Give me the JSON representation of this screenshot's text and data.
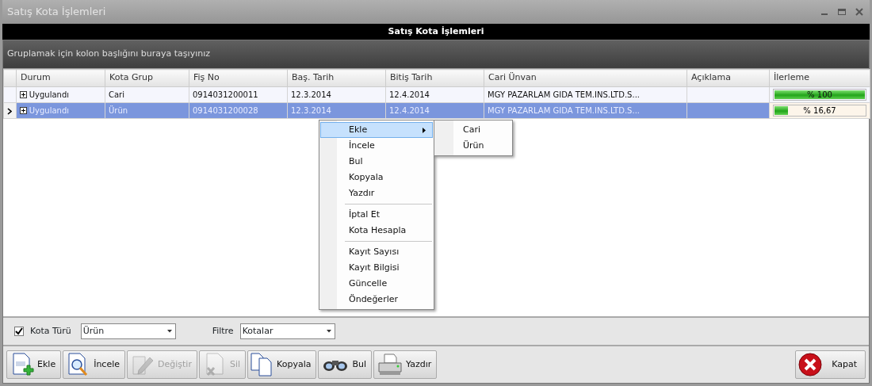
{
  "window": {
    "title": "Satış Kota İşlemleri"
  },
  "header": {
    "title": "Satış Kota İşlemleri"
  },
  "group_panel": {
    "hint": "Gruplamak için kolon başlığını buraya taşıyınız"
  },
  "table": {
    "columns": [
      "Durum",
      "Kota Grup",
      "Fiş No",
      "Baş. Tarih",
      "Bitiş Tarih",
      "Cari Ünvan",
      "Açıklama",
      "İlerleme"
    ],
    "rows": [
      {
        "selected": false,
        "cells": [
          "Uygulandı",
          "Cari",
          "0914031200011",
          "12.3.2014",
          "12.4.2014",
          "MGY PAZARLAM GIDA TEM.INS.LTD.S...",
          ""
        ],
        "progress": {
          "level": 1,
          "reading": "% 100"
        }
      },
      {
        "selected": true,
        "cells": [
          "Uygulandı",
          "Ürün",
          "0914031200028",
          "12.3.2014",
          "12.4.2014",
          "MGY PAZARLAM GIDA TEM.INS.LTD.S...",
          ""
        ],
        "progress": {
          "level": 0.1667,
          "reading": "% 16,67"
        }
      }
    ]
  },
  "context_menu": {
    "items": [
      {
        "kind": "item",
        "label": "Ekle",
        "selected": true,
        "submenu": true
      },
      {
        "kind": "item",
        "label": "İncele",
        "selected": false,
        "submenu": false
      },
      {
        "kind": "item",
        "label": "Bul",
        "selected": false,
        "submenu": false
      },
      {
        "kind": "item",
        "label": "Kopyala",
        "selected": false,
        "submenu": false
      },
      {
        "kind": "item",
        "label": "Yazdır",
        "selected": false,
        "submenu": false
      },
      {
        "kind": "separator"
      },
      {
        "kind": "item",
        "label": "İptal Et",
        "selected": false,
        "submenu": false
      },
      {
        "kind": "item",
        "label": "Kota Hesapla",
        "selected": false,
        "submenu": false
      },
      {
        "kind": "separator"
      },
      {
        "kind": "item",
        "label": "Kayıt Sayısı",
        "selected": false,
        "submenu": false
      },
      {
        "kind": "item",
        "label": "Kayıt Bilgisi",
        "selected": false,
        "submenu": false
      },
      {
        "kind": "item",
        "label": "Güncelle",
        "selected": false,
        "submenu": false
      },
      {
        "kind": "item",
        "label": "Öndeğerler",
        "selected": false,
        "submenu": false
      }
    ],
    "submenu": [
      "Cari",
      "Ürün"
    ]
  },
  "filters": {
    "kota_turu": {
      "label": "Kota Türü",
      "checked": true,
      "value": "Ürün"
    },
    "filtre": {
      "label": "Filtre",
      "value": "Kotalar"
    }
  },
  "buttons": [
    {
      "kind": "add",
      "label": "Ekle",
      "disabled": false
    },
    {
      "kind": "inspect",
      "label": "İncele",
      "disabled": false
    },
    {
      "kind": "edit",
      "label": "Değiştir",
      "disabled": true
    },
    {
      "kind": "delete",
      "label": "Sil",
      "disabled": true
    },
    {
      "kind": "copy",
      "label": "Kopyala",
      "disabled": false
    },
    {
      "kind": "find",
      "label": "Bul",
      "disabled": false
    },
    {
      "kind": "print",
      "label": "Yazdır",
      "disabled": false
    }
  ],
  "close_button": {
    "label": "Kapat"
  }
}
